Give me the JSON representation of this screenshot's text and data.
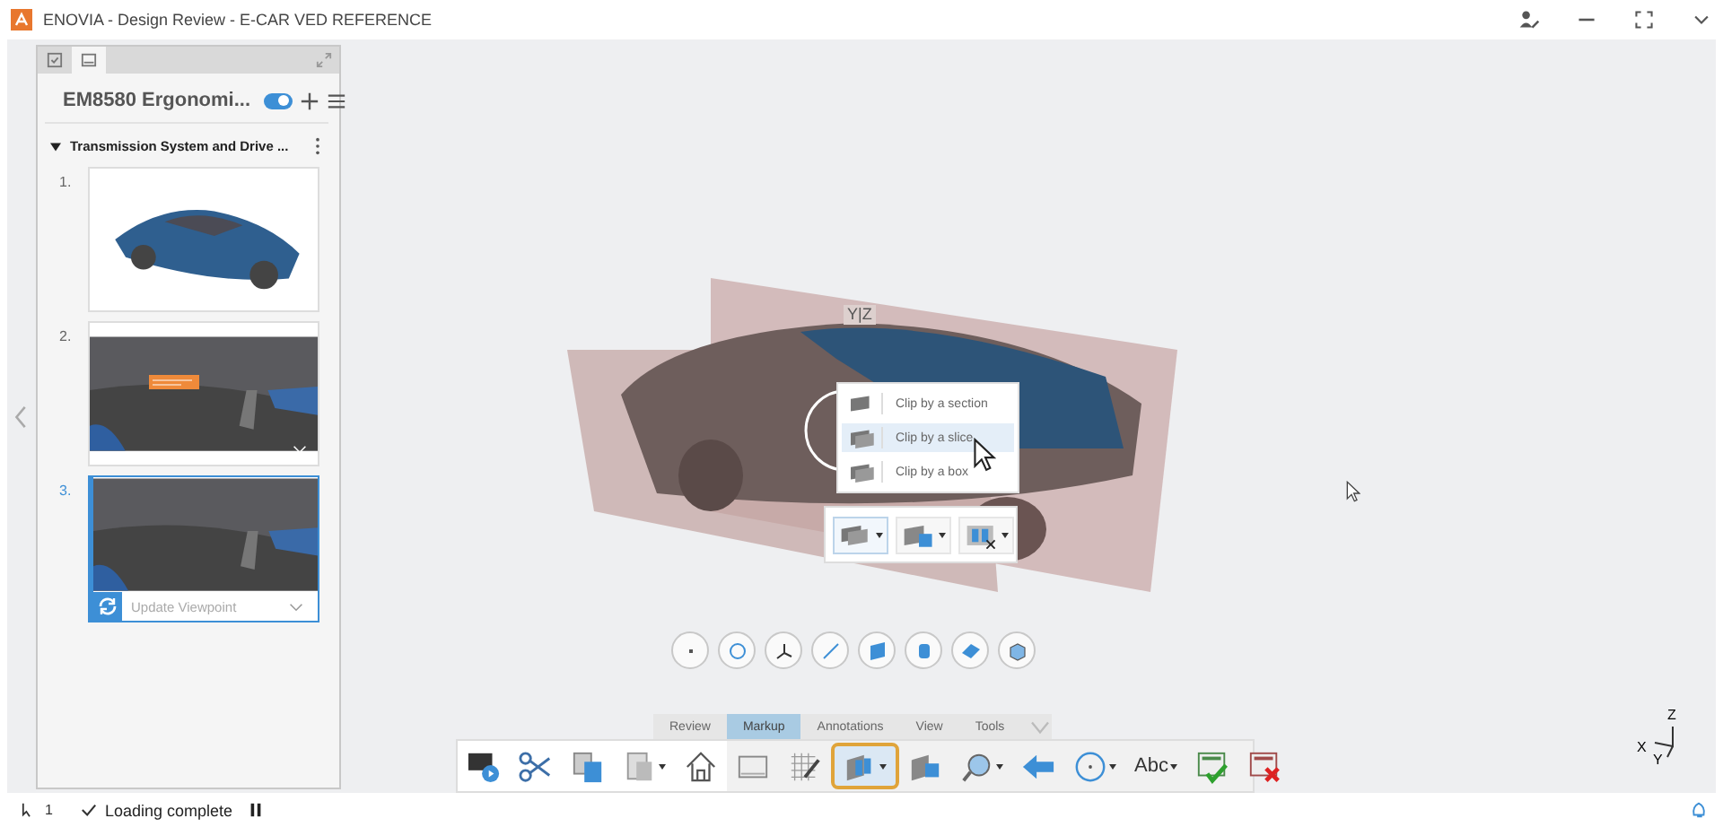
{
  "window": {
    "title": "ENOVIA - Design Review - E-CAR VED REFERENCE"
  },
  "panel": {
    "title": "EM8580 Ergonomi...",
    "toggle_on": true,
    "section": {
      "title": "Transmission System and Drive ...",
      "expanded": true
    },
    "slides": [
      {
        "number": "1.",
        "kind": "exterior",
        "selected": false
      },
      {
        "number": "2.",
        "kind": "interior-note",
        "selected": false
      },
      {
        "number": "3.",
        "kind": "interior",
        "selected": true,
        "action": "Update Viewpoint"
      }
    ]
  },
  "scene": {
    "manipulator_label": "Y|Z"
  },
  "clip_menu": {
    "items": [
      {
        "label": "Clip by a section",
        "selected": false
      },
      {
        "label": "Clip by a slice",
        "selected": true
      },
      {
        "label": "Clip by a box",
        "selected": false
      }
    ]
  },
  "ribbon": {
    "tabs": [
      {
        "label": "Review",
        "selected": false
      },
      {
        "label": "Markup",
        "selected": true
      },
      {
        "label": "Annotations",
        "selected": false
      },
      {
        "label": "View",
        "selected": false
      },
      {
        "label": "Tools",
        "selected": false
      }
    ],
    "tools": [
      {
        "kind": "screen-play",
        "selected": false
      },
      {
        "kind": "scissors",
        "selected": false
      },
      {
        "kind": "copy",
        "selected": false
      },
      {
        "kind": "paste",
        "selected": false
      },
      {
        "kind": "home",
        "selected": false
      },
      {
        "kind": "frame",
        "selected": false
      },
      {
        "kind": "grid-pen",
        "selected": false
      },
      {
        "kind": "clip",
        "selected": true
      },
      {
        "kind": "clip-box",
        "selected": false
      },
      {
        "kind": "measure",
        "selected": false
      },
      {
        "kind": "arrow",
        "selected": false
      },
      {
        "kind": "circle",
        "selected": false
      },
      {
        "kind": "text",
        "label": "Abc",
        "selected": false
      },
      {
        "kind": "accept",
        "selected": false
      },
      {
        "kind": "reject",
        "selected": false
      }
    ]
  },
  "axis_triad": {
    "z": "Z",
    "x": "X",
    "y": "Y"
  },
  "status_bar": {
    "selection_count": "1",
    "message": "Loading complete"
  }
}
